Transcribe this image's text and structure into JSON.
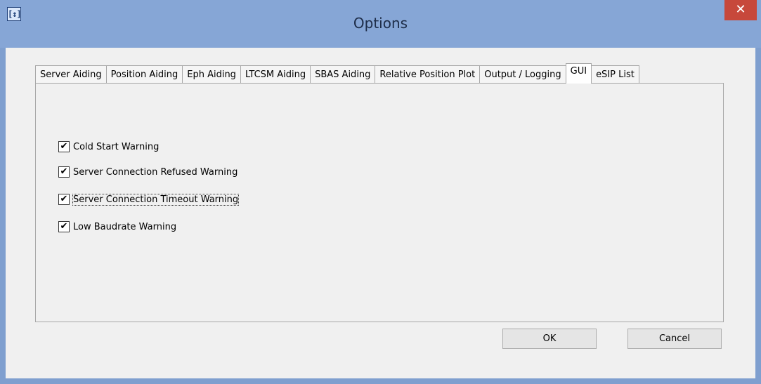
{
  "window": {
    "title": "Options",
    "app_icon": "[↕]",
    "close_glyph": "✕"
  },
  "tabs": [
    {
      "label": "Server Aiding",
      "active": false
    },
    {
      "label": "Position Aiding",
      "active": false
    },
    {
      "label": "Eph Aiding",
      "active": false
    },
    {
      "label": "LTCSM Aiding",
      "active": false
    },
    {
      "label": "SBAS Aiding",
      "active": false
    },
    {
      "label": "Relative Position Plot",
      "active": false
    },
    {
      "label": "Output / Logging",
      "active": false
    },
    {
      "label": "GUI",
      "active": true
    },
    {
      "label": "eSIP List",
      "active": false
    }
  ],
  "gui_options": [
    {
      "label": "Cold Start Warning",
      "checked": true,
      "mark": "✔"
    },
    {
      "label": "Server Connection Refused Warning",
      "checked": true,
      "mark": "✔"
    },
    {
      "label": "Server Connection Timeout Warning",
      "checked": true,
      "mark": "✔"
    },
    {
      "label": "Low Baudrate Warning",
      "checked": true,
      "mark": "✔"
    }
  ],
  "buttons": {
    "ok": "OK",
    "cancel": "Cancel"
  },
  "colors": {
    "titlebar": "#86a6d6",
    "close": "#c7483b",
    "dialog": "#f0f0f0"
  }
}
